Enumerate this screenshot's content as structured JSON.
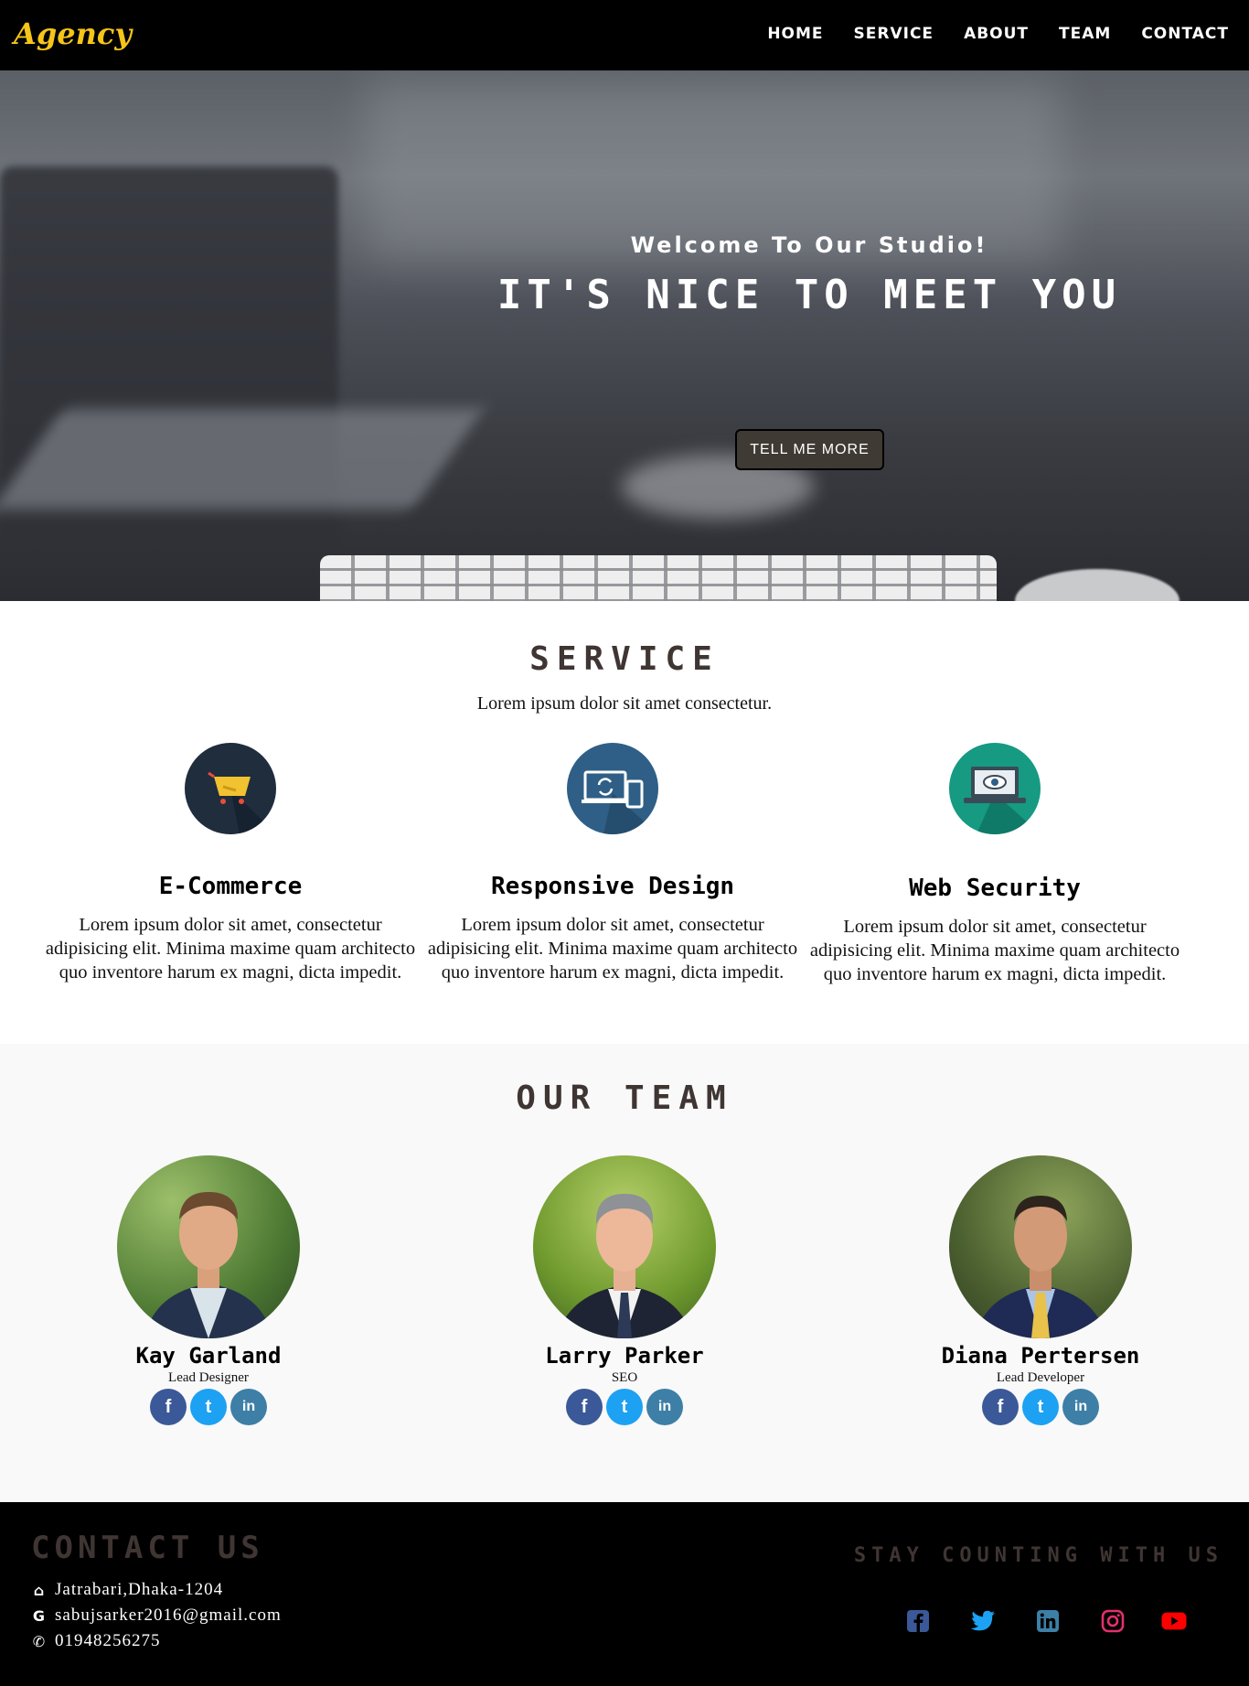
{
  "nav": {
    "logo": "Agency",
    "items": [
      "HOME",
      "SERVICE",
      "ABOUT",
      "TEAM",
      "CONTACT"
    ]
  },
  "hero": {
    "welcome": "Welcome To Our Studio!",
    "headline": "IT'S NICE TO MEET YOU",
    "cta": "TELL ME MORE"
  },
  "service": {
    "title": "SERVICE",
    "subtitle": "Lorem ipsum dolor sit amet consectetur.",
    "items": [
      {
        "icon": "shopping-cart-icon",
        "title": "E-Commerce",
        "text": "Lorem ipsum dolor sit amet, consectetur adipisicing elit. Minima maxime quam architecto quo inventore harum ex magni, dicta impedit.",
        "color": "#1f2d3d"
      },
      {
        "icon": "responsive-devices-icon",
        "title": "Responsive Design",
        "text": "Lorem ipsum dolor sit amet, consectetur adipisicing elit. Minima maxime quam architecto quo inventore harum ex magni, dicta impedit.",
        "color": "#2f5f86"
      },
      {
        "icon": "laptop-eye-icon",
        "title": "Web Security",
        "text": "Lorem ipsum dolor sit amet, consectetur adipisicing elit. Minima maxime quam architecto quo inventore harum ex magni, dicta impedit.",
        "color": "#169a82"
      }
    ]
  },
  "team": {
    "title": "OUR TEAM",
    "members": [
      {
        "name": "Kay Garland",
        "role": "Lead Designer"
      },
      {
        "name": "Larry Parker",
        "role": "SEO"
      },
      {
        "name": "Diana Pertersen",
        "role": "Lead Developer"
      }
    ],
    "social_labels": {
      "fb": "f",
      "tw": "t",
      "li": "in"
    }
  },
  "footer": {
    "contact_title": "CONTACT US",
    "address": "Jatrabari,Dhaka-1204",
    "email": "sabujsarker2016@gmail.com",
    "phone": "01948256275",
    "icons": {
      "home": "⌂",
      "google": "G",
      "phone": "✆"
    },
    "stay_title": "STAY COUNTING WITH US",
    "social_colors": {
      "facebook": "#3b5998",
      "twitter": "#1da1f2",
      "linkedin": "#3d7fa6",
      "instagram": "#e1306c",
      "youtube": "#ff0000"
    }
  }
}
